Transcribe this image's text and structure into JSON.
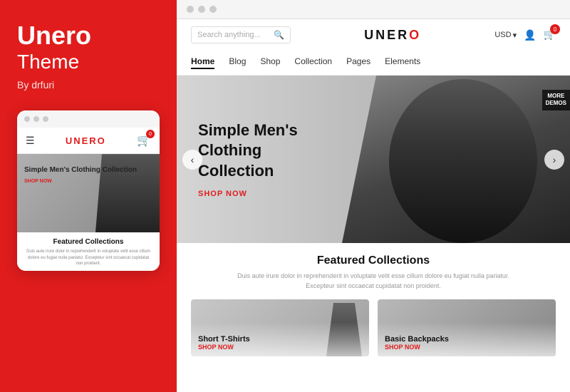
{
  "left": {
    "brand": {
      "title": "Unero",
      "subtitle": "Theme",
      "author": "By drfuri"
    },
    "mobile": {
      "logo": "UNER",
      "logo_o": "O",
      "hero_title": "Simple Men's Clothing Collection",
      "hero_cta": "Shop Now",
      "featured_title": "Featured Collections",
      "featured_desc": "Duis aute irure dolor in reprehenderit in voluptate velit esse cillum dolore eu fugiat nulla pariatur. Excepteur sint occaecat cupidatat non proident."
    }
  },
  "browser": {
    "dots": [
      "dot1",
      "dot2",
      "dot3"
    ]
  },
  "header": {
    "search_placeholder": "Search anything...",
    "logo": "UNER",
    "logo_o": "O",
    "currency": "USD",
    "cart_count": "0"
  },
  "nav": {
    "items": [
      {
        "label": "Home",
        "active": true
      },
      {
        "label": "Blog",
        "active": false
      },
      {
        "label": "Shop",
        "active": false
      },
      {
        "label": "Collection",
        "active": false
      },
      {
        "label": "Pages",
        "active": false
      },
      {
        "label": "Elements",
        "active": false
      }
    ]
  },
  "hero": {
    "title": "Simple Men's Clothing Collection",
    "cta": "Shop Now",
    "more_demos": "MORE\nDEMOS"
  },
  "featured": {
    "title": "Featured Collections",
    "desc_line1": "Duis aute irure dolor in reprehenderit in voluptate velit esse cillum dolore eu fugiat nulla pariatur.",
    "desc_line2": "Excepteur sint occaecat cupidatat non proident.",
    "collections": [
      {
        "name": "Short T-Shirts",
        "cta": "Shop Now"
      },
      {
        "name": "Basic Backpacks",
        "cta": "Shop Now"
      }
    ]
  }
}
